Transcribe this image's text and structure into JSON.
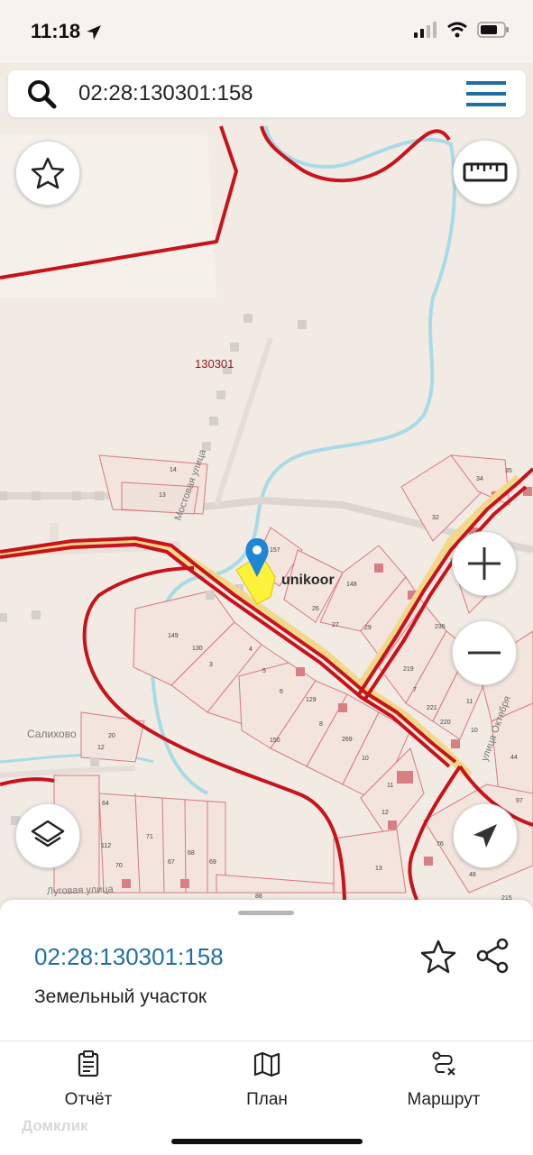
{
  "status_bar": {
    "time": "11:18"
  },
  "search": {
    "query": "02:28:130301:158"
  },
  "map": {
    "district_label": "130301",
    "watermark": "unikoor",
    "street_labels": [
      "Мостовая улица",
      "Салихово",
      "Луговая улица",
      "улица Октября"
    ],
    "plot_numbers": [
      "157",
      "14",
      "13",
      "149",
      "148",
      "26",
      "27",
      "29",
      "130",
      "3",
      "4",
      "5",
      "6",
      "129",
      "8",
      "150",
      "269",
      "10",
      "11",
      "12",
      "219",
      "235",
      "221",
      "220",
      "7",
      "11",
      "10",
      "32",
      "34",
      "35",
      "44",
      "97",
      "48",
      "215",
      "76",
      "13",
      "71",
      "67",
      "68",
      "69",
      "70",
      "88",
      "112",
      "64",
      "20",
      "12"
    ]
  },
  "place": {
    "cadastral_number": "02:28:130301:158",
    "type": "Земельный участок"
  },
  "tabs": [
    {
      "label": "Отчёт",
      "icon": "clipboard-icon"
    },
    {
      "label": "План",
      "icon": "map-icon"
    },
    {
      "label": "Маршрут",
      "icon": "route-icon"
    }
  ],
  "brand_watermark": "Домклик",
  "colors": {
    "accent": "#1f6fa6",
    "boundary": "#c8121c",
    "road": "#f2d98a",
    "selected_plot": "#fff23a",
    "river": "#a8dbe6",
    "pin": "#1e86d6"
  }
}
